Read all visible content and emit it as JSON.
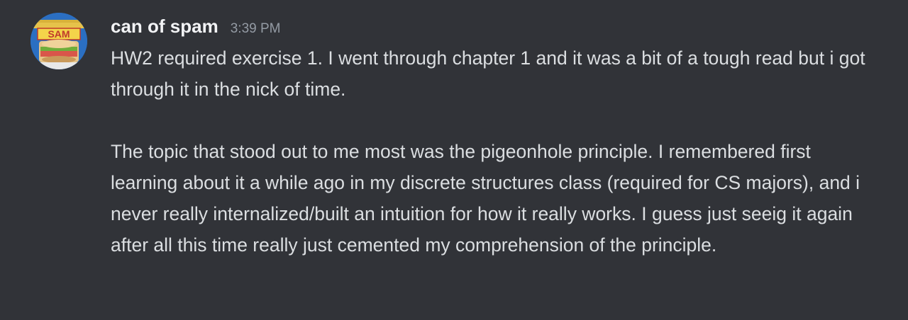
{
  "message": {
    "author": "can of spam",
    "timestamp": "3:39 PM",
    "avatar_text": "SAM",
    "paragraphs": [
      "HW2 required exercise 1. I went through chapter 1 and it was a bit of a tough read but i got through it in the nick of time.",
      "The topic that stood out to me most was the pigeonhole principle. I remembered first learning about it a while ago in my discrete structures class (required for CS majors), and i never really internalized/built an intuition for how it really works. I guess just seeig it again after all this time really just cemented my comprehension of the principle."
    ]
  },
  "colors": {
    "background": "#313338",
    "username": "#f2f3f5",
    "text": "#dbdee1",
    "timestamp": "#949ba4",
    "avatar_can_blue": "#2b6fc2"
  },
  "icons": {
    "avatar": "spam-can-avatar-icon"
  }
}
